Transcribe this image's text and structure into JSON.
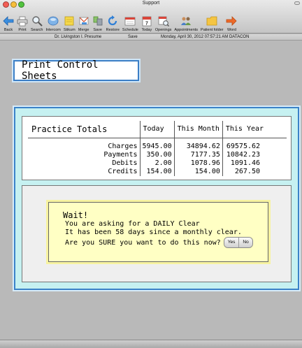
{
  "window": {
    "title": "Support"
  },
  "toolbar": {
    "items": [
      {
        "label": "Back",
        "icon": "back-arrow-icon"
      },
      {
        "label": "Print",
        "icon": "printer-icon"
      },
      {
        "label": "Search",
        "icon": "magnifier-icon"
      },
      {
        "label": "Intercom",
        "icon": "intercom-icon"
      },
      {
        "label": "Stikum",
        "icon": "sticky-note-icon"
      },
      {
        "label": "Merge",
        "icon": "merge-icon"
      },
      {
        "label": "Save",
        "icon": "save-icon"
      },
      {
        "label": "Restore",
        "icon": "restore-icon"
      },
      {
        "label": "Schedule",
        "icon": "schedule-icon"
      },
      {
        "label": "Today",
        "icon": "calendar-icon"
      },
      {
        "label": "Openings",
        "icon": "openings-icon"
      },
      {
        "label": "Appointments",
        "icon": "appointments-icon"
      },
      {
        "label": "Patient folder",
        "icon": "folder-icon"
      },
      {
        "label": "Word",
        "icon": "arrow-right-icon"
      }
    ]
  },
  "info": {
    "user": "Dr. Livingston I. Presume",
    "save": "Save",
    "datetime": "Monday, April 30, 2012  07:57:21 AM  DATACON"
  },
  "page": {
    "title": "Print Control Sheets"
  },
  "totals": {
    "title": "Practice Totals",
    "columns": [
      "Today",
      "This Month",
      "This Year"
    ],
    "rows": [
      {
        "label": "Charges",
        "today": "5945.00",
        "month": "34894.62",
        "year": "69575.62"
      },
      {
        "label": "Payments",
        "today": "350.00",
        "month": "7177.35",
        "year": "10842.23"
      },
      {
        "label": "Debits",
        "today": "2.00",
        "month": "1078.96",
        "year": "1091.46"
      },
      {
        "label": "Credits",
        "today": "154.00",
        "month": "154.00",
        "year": "267.50"
      }
    ]
  },
  "dialog": {
    "heading": "Wait!",
    "line1": "You are asking for a DAILY Clear",
    "line2": "It has been 58 days since a monthly clear.",
    "line3": "Are you SURE you want to do this now?",
    "yes": "Yes",
    "no": "No"
  },
  "colors": {
    "panel_bg": "#c6f1f1",
    "panel_border": "#3b82c8",
    "dialog_bg": "#ffffc4"
  }
}
